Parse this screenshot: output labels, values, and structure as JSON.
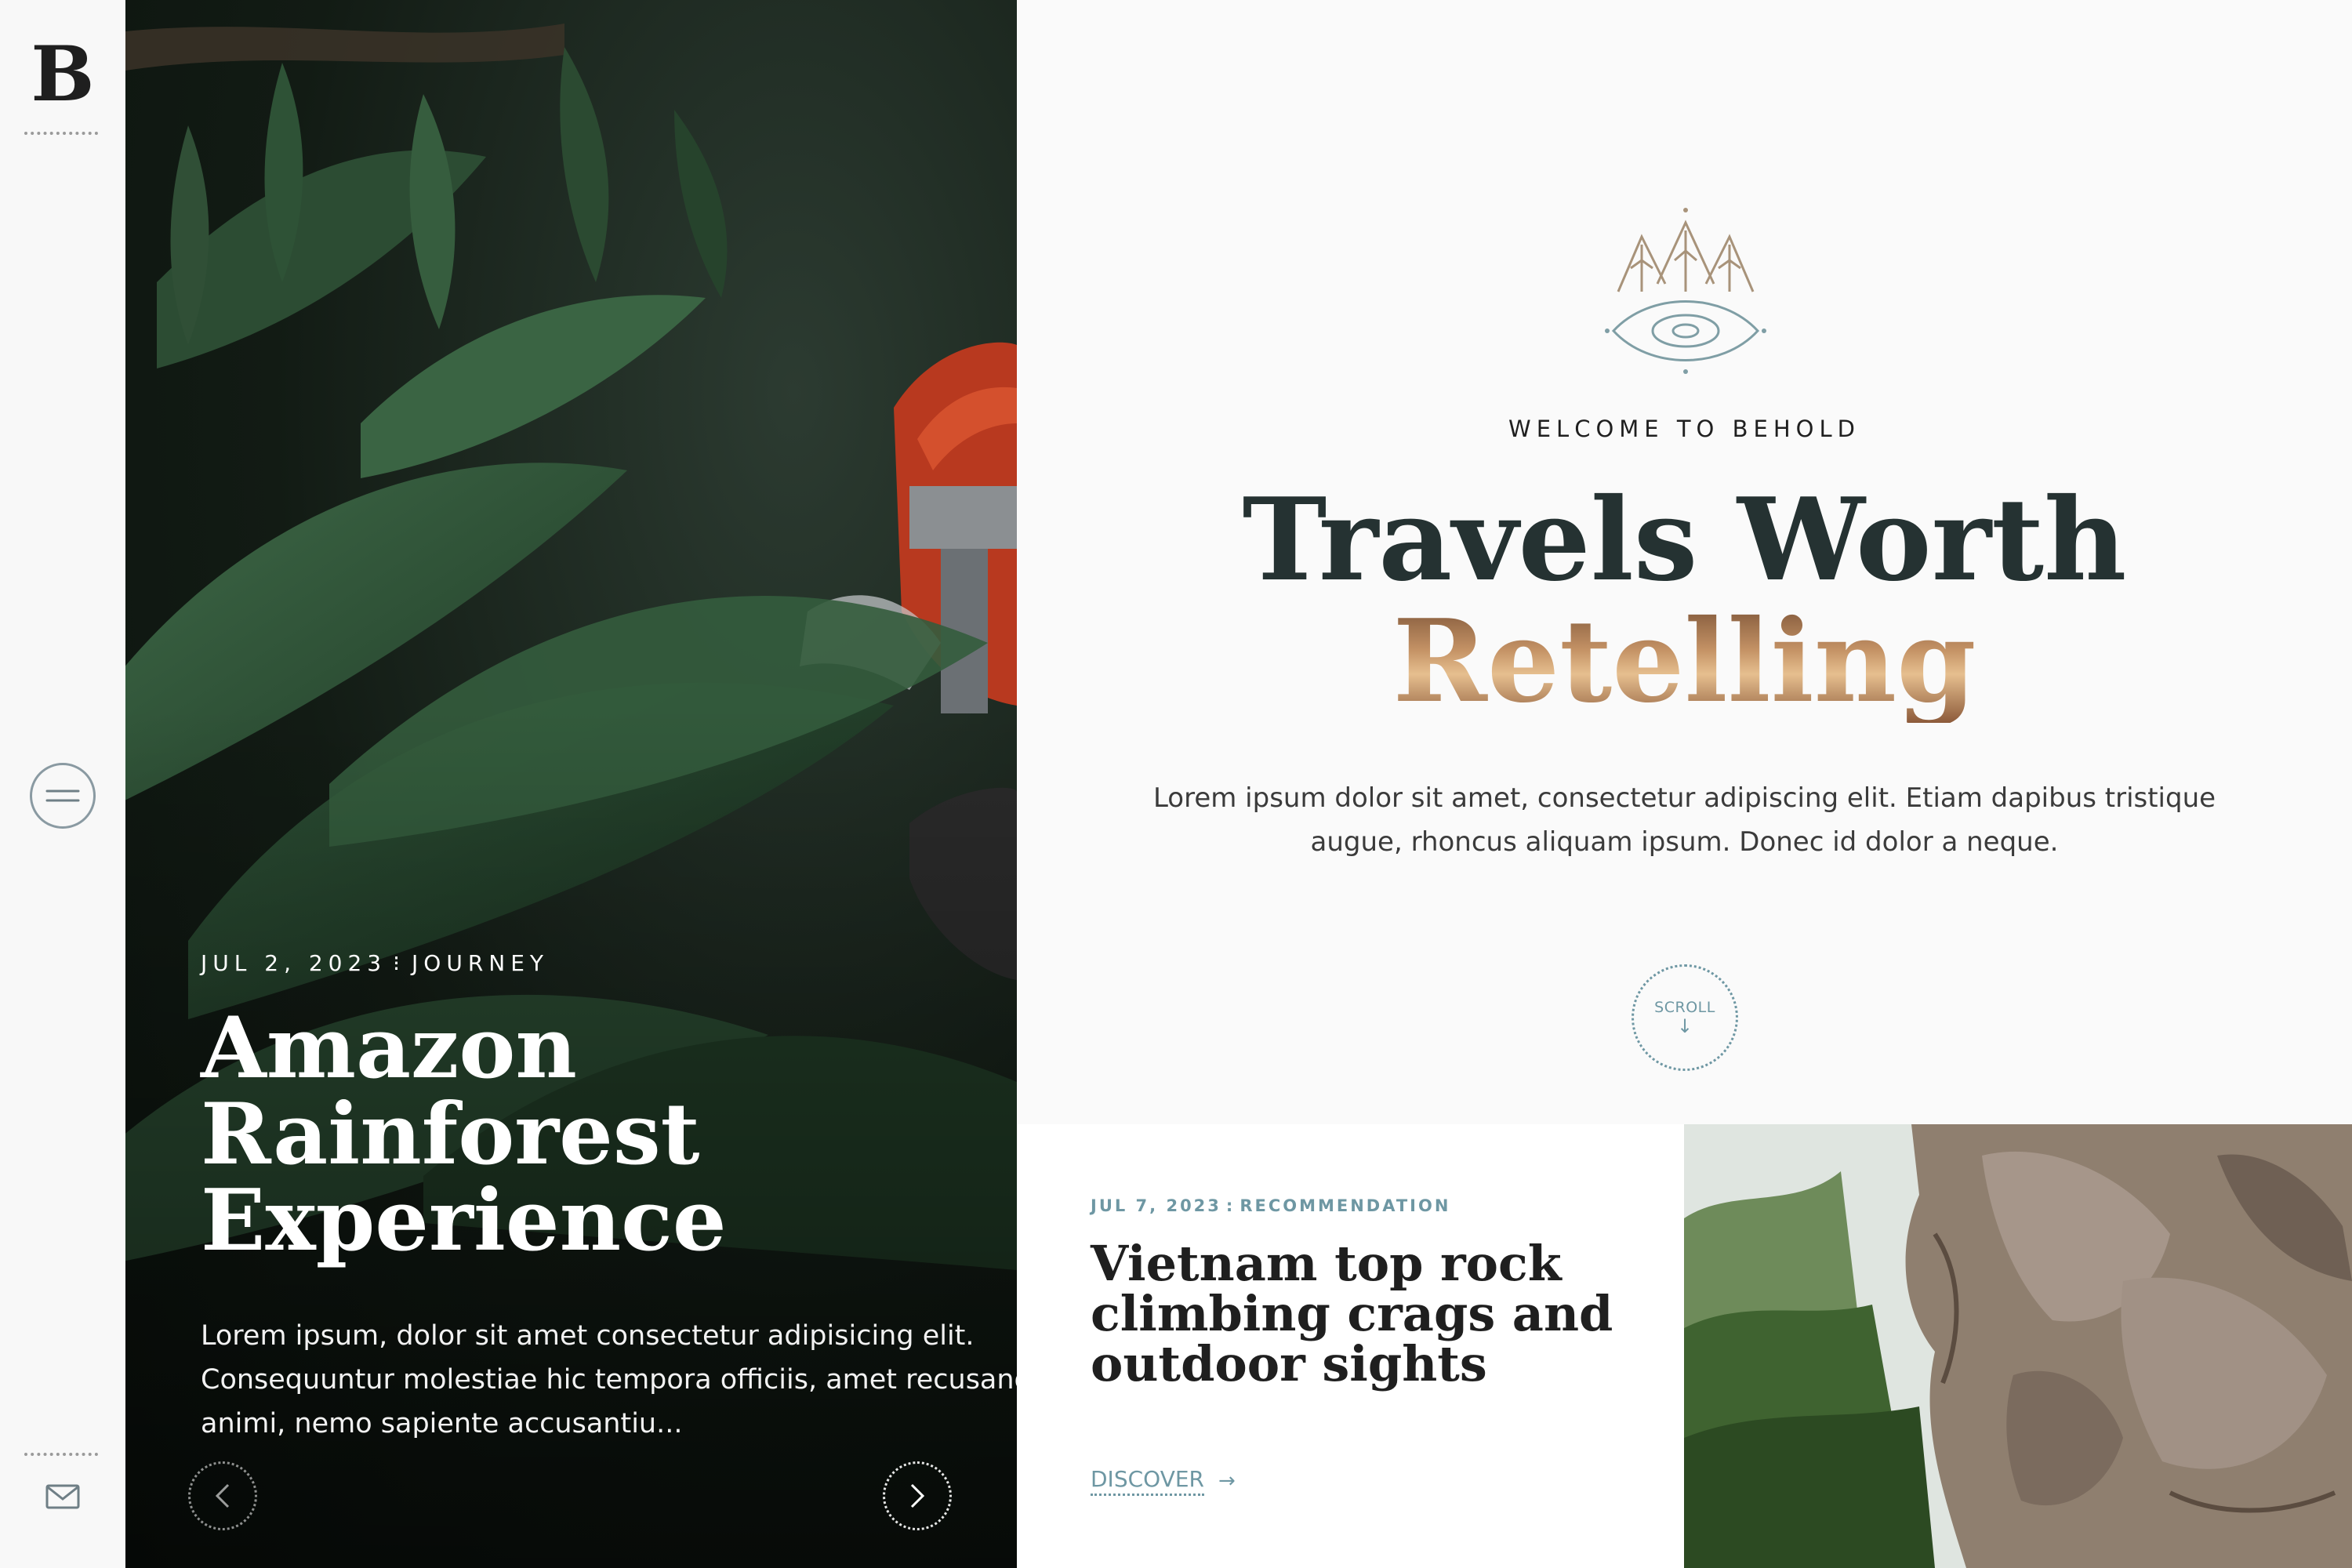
{
  "sidebar": {
    "brand_letter": "B",
    "menu_icon": "hamburger-menu-icon",
    "mail_icon": "envelope-icon"
  },
  "hero_slide": {
    "date": "JUL 2, 2023",
    "separator": "⁝",
    "category": "JOURNEY",
    "title_lines": [
      "Amazon",
      "Rainforest",
      "Experience"
    ],
    "excerpt_lines": [
      "Lorem ipsum, dolor sit amet consectetur adipisicing elit.",
      "Consequuntur molestiae hic tempora officiis, amet recusandae",
      "animi, nemo sapiente accusantiu..."
    ],
    "prev_icon": "chevron-left-icon",
    "next_icon": "chevron-right-icon"
  },
  "welcome": {
    "logo_icon": "mountain-eye-logo-icon",
    "label": "WELCOME TO BEHOLD",
    "title_line1": "Travels Worth",
    "title_line2": "Retelling",
    "description_lines": [
      "Lorem ipsum dolor sit amet, consectetur adipiscing elit. Etiam dapibus tristique",
      "augue, rhoncus aliquam ipsum. Donec id dolor a neque."
    ],
    "scroll_label": "SCROLL",
    "scroll_arrow": "↓"
  },
  "featured_post": {
    "date": "JUL 7, 2023",
    "separator": ":",
    "category": "RECOMMENDATION",
    "title_lines": [
      "Vietnam top rock",
      "climbing crags and",
      "outdoor sights"
    ],
    "cta_label": "DISCOVER",
    "cta_arrow": "→"
  },
  "colors": {
    "accent": "#6e97a3",
    "dark_text": "#1f1f1f",
    "title_dark": "#253232",
    "title_warm": "#a87a52",
    "background": "#fafafa"
  }
}
